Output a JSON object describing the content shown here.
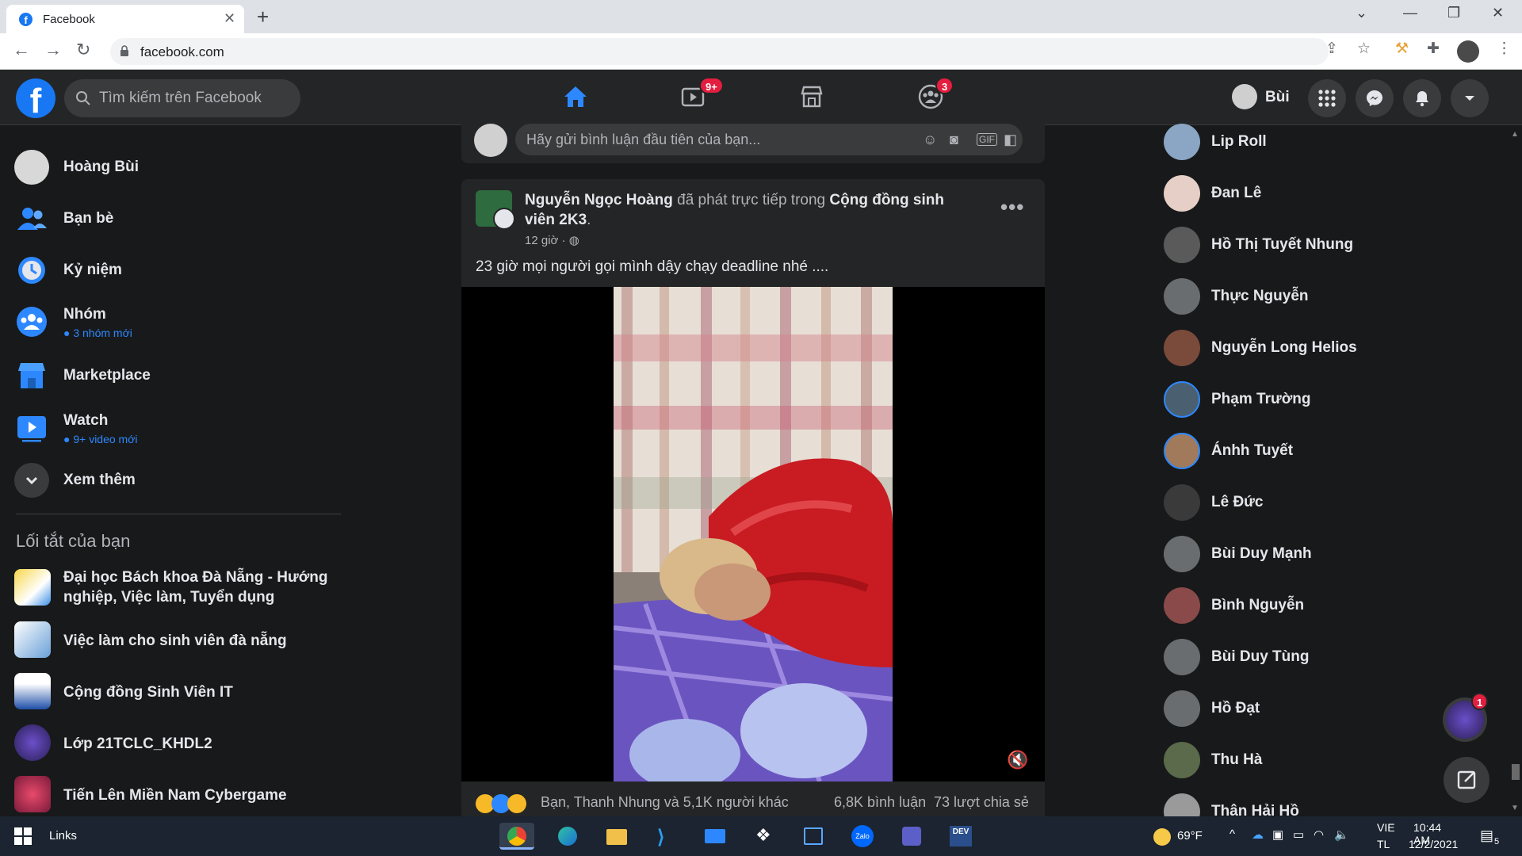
{
  "browser": {
    "tab_title": "Facebook",
    "url": "facebook.com"
  },
  "header": {
    "search_placeholder": "Tìm kiếm trên Facebook",
    "watch_badge": "9+",
    "groups_badge": "3",
    "profile_name": "Bùi"
  },
  "sidebar": {
    "items": [
      {
        "label": "Hoàng Bùi",
        "sub": ""
      },
      {
        "label": "Bạn bè",
        "sub": ""
      },
      {
        "label": "Kỷ niệm",
        "sub": ""
      },
      {
        "label": "Nhóm",
        "sub": "● 3 nhóm mới"
      },
      {
        "label": "Marketplace",
        "sub": ""
      },
      {
        "label": "Watch",
        "sub": "● 9+ video mới"
      },
      {
        "label": "Xem thêm",
        "sub": ""
      }
    ],
    "shortcuts_title": "Lối tắt của bạn",
    "shortcuts": [
      {
        "label": "Đại học Bách khoa Đà Nẵng - Hướng nghiệp, Việc làm, Tuyển dụng"
      },
      {
        "label": "Việc làm cho sinh viên đà nẵng"
      },
      {
        "label": "Cộng đồng Sinh Viên IT"
      },
      {
        "label": "Lớp 21TCLC_KHDL2"
      },
      {
        "label": "Tiến Lên Miền Nam Cybergame"
      }
    ]
  },
  "feed": {
    "comment_placeholder": "Hãy gửi bình luận đầu tiên của bạn...",
    "post": {
      "author": "Nguyễn Ngọc Hoàng",
      "action": " đã phát trực tiếp trong ",
      "group": "Cộng đồng sinh viên 2K3",
      "time": "12 giờ · ",
      "text": "23 giờ mọi người gọi mình dậy chạy deadline nhé ....",
      "reactions_text": "Bạn, Thanh Nhung và 5,1K người khác",
      "comments": "6,8K bình luận",
      "shares": "73 lượt chia sẻ"
    }
  },
  "contacts": [
    "Lip Roll",
    "Đan Lê",
    "Hồ Thị Tuyết Nhung",
    "Thực Nguyễn",
    "Nguyễn Long Helios",
    "Phạm Trường",
    "Ánhh Tuyết",
    "Lê Đức",
    "Bùi Duy Mạnh",
    "Bình Nguyễn",
    "Bùi Duy Tùng",
    "Hồ Đạt",
    "Thu Hà",
    "Thân Hải Hồ"
  ],
  "chat_badge": "1",
  "taskbar": {
    "links_label": "Links",
    "weather": "69°F",
    "lang_top": "VIE",
    "lang_bottom": "TL",
    "time": "10:44 AM",
    "date": "12/2/2021",
    "notif_count": "5"
  },
  "colors": {
    "accent": "#2d88ff",
    "brand": "#1877f2",
    "badge": "#e41e3f",
    "bg": "#18191a",
    "surface": "#242526"
  }
}
